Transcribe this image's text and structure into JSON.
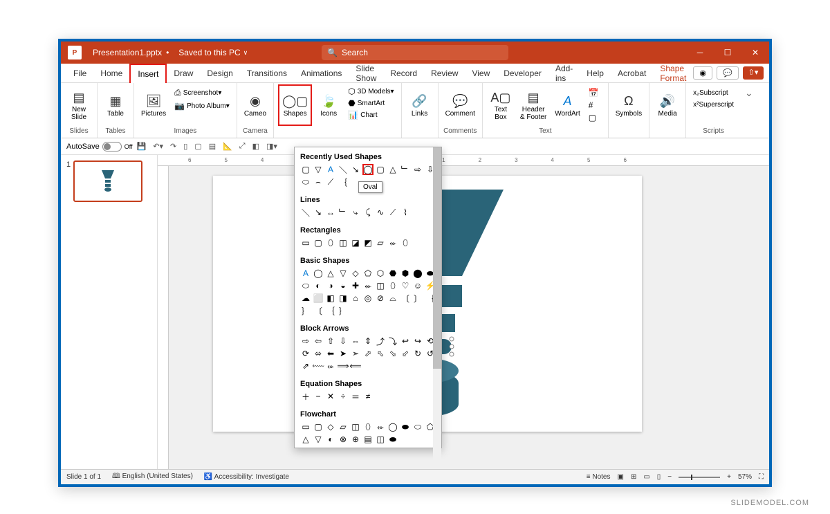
{
  "titlebar": {
    "filename": "Presentation1.pptx",
    "saved_status": "Saved to this PC",
    "search_placeholder": "Search"
  },
  "tabs": {
    "file": "File",
    "home": "Home",
    "insert": "Insert",
    "draw": "Draw",
    "design": "Design",
    "transitions": "Transitions",
    "animations": "Animations",
    "slideshow": "Slide Show",
    "record": "Record",
    "review": "Review",
    "view": "View",
    "developer": "Developer",
    "addins": "Add-ins",
    "help": "Help",
    "acrobat": "Acrobat",
    "shapeformat": "Shape Format"
  },
  "ribbon": {
    "new_slide": "New\nSlide",
    "table": "Table",
    "pictures": "Pictures",
    "screenshot": "Screenshot",
    "photo_album": "Photo Album",
    "cameo": "Cameo",
    "shapes": "Shapes",
    "icons": "Icons",
    "models3d": "3D Models",
    "smartart": "SmartArt",
    "chart": "Chart",
    "links": "Links",
    "comment": "Comment",
    "textbox": "Text\nBox",
    "headerfooter": "Header\n& Footer",
    "wordart": "WordArt",
    "symbols": "Symbols",
    "media": "Media",
    "subscript": "Subscript",
    "superscript": "Superscript",
    "group_slides": "Slides",
    "group_tables": "Tables",
    "group_images": "Images",
    "group_camera": "Camera",
    "group_comments": "Comments",
    "group_text": "Text",
    "group_scripts": "Scripts"
  },
  "qat": {
    "autosave": "AutoSave",
    "autosave_state": "Off"
  },
  "shapes_menu": {
    "recently_used": "Recently Used Shapes",
    "lines": "Lines",
    "rectangles": "Rectangles",
    "basic_shapes": "Basic Shapes",
    "block_arrows": "Block Arrows",
    "equation_shapes": "Equation Shapes",
    "flowchart": "Flowchart",
    "oval_tooltip": "Oval"
  },
  "statusbar": {
    "slide_info": "Slide 1 of 1",
    "language": "English (United States)",
    "accessibility": "Accessibility: Investigate",
    "notes": "Notes",
    "zoom": "57%"
  },
  "thumbnail": {
    "number": "1"
  },
  "watermark": "SLIDEMODEL.COM"
}
